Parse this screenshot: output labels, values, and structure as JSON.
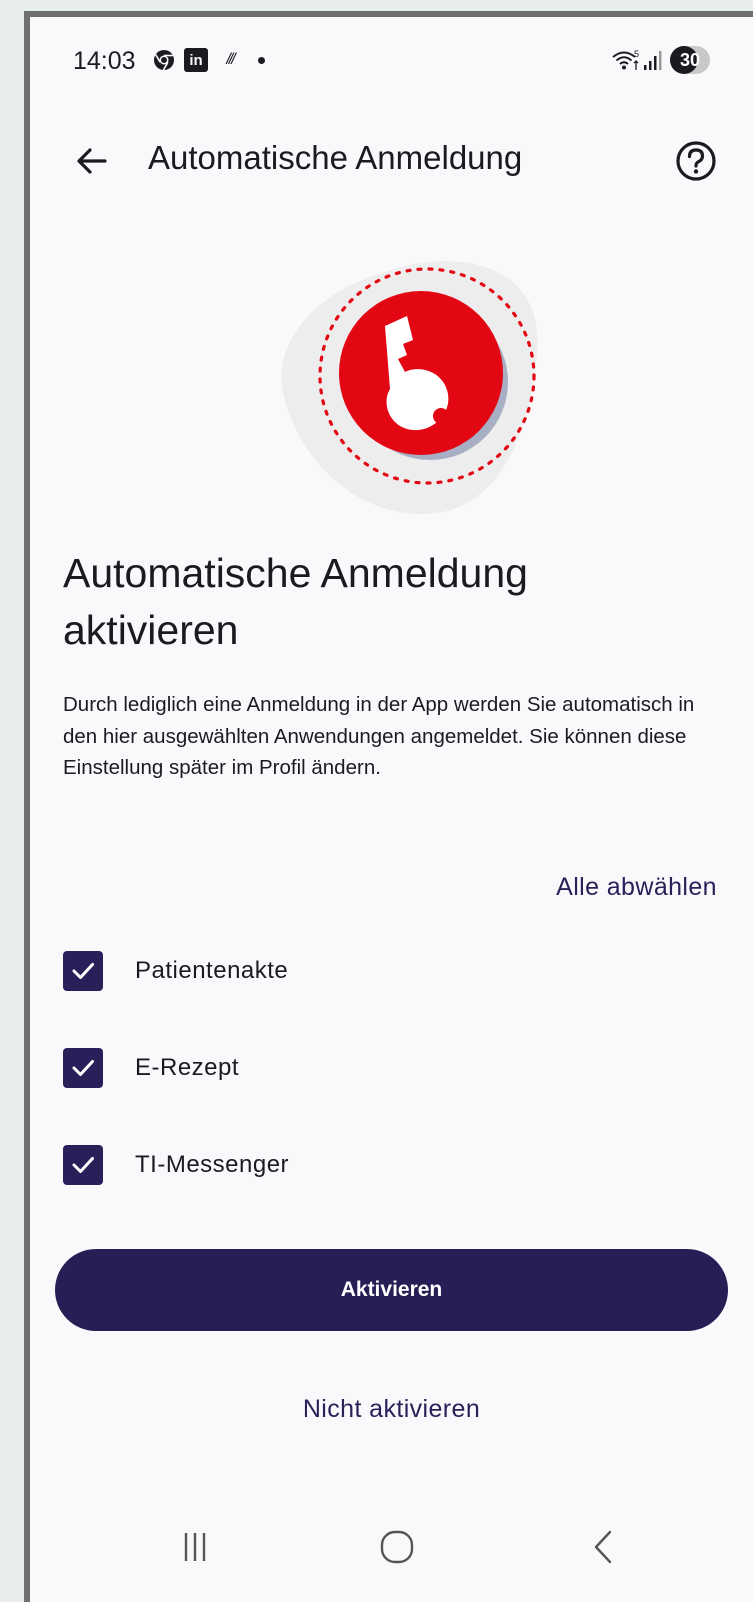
{
  "status_bar": {
    "time": "14:03",
    "linkedin_text": "in",
    "swipe_text": "///",
    "battery": "30"
  },
  "app_bar": {
    "title": "Automatische Anmeldung"
  },
  "content": {
    "heading": "Automatische Anmeldung aktivieren",
    "description": "Durch lediglich eine Anmeldung in der App werden Sie automatisch in den hier ausgewählten Anwendungen angemeldet. Sie können diese Einstellung später im Profil ändern.",
    "deselect_all": "Alle abwählen",
    "options": [
      {
        "label": "Patientenakte",
        "checked": true
      },
      {
        "label": "E-Rezept",
        "checked": true
      },
      {
        "label": "TI-Messenger",
        "checked": true
      }
    ]
  },
  "actions": {
    "primary": "Aktivieren",
    "secondary": "Nicht aktivieren"
  },
  "colors": {
    "primary": "#261f55",
    "accent_red": "#e30613",
    "background": "#fbf8fc"
  },
  "icons": [
    "back-arrow-icon",
    "help-icon",
    "key-icon",
    "check-icon",
    "recents-icon",
    "home-icon",
    "back-icon"
  ]
}
